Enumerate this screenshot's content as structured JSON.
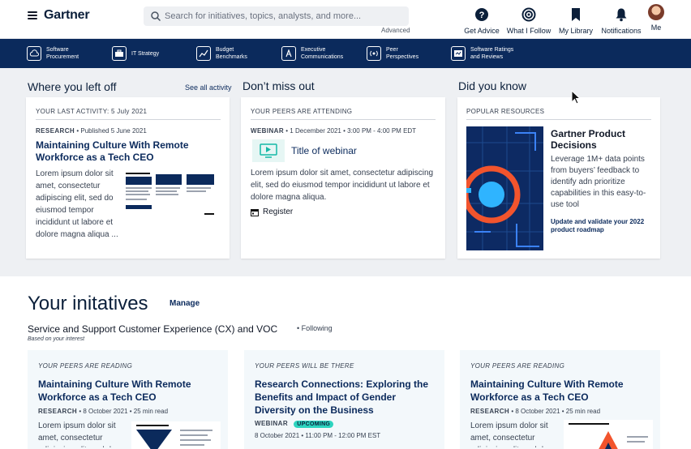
{
  "header": {
    "logo": "Gartner",
    "search_placeholder": "Search for initiatives, topics, analysts, and more...",
    "advanced": "Advanced",
    "nav": [
      {
        "label": "Get Advice",
        "icon": "question-circle-icon"
      },
      {
        "label": "What I Follow",
        "icon": "radar-icon"
      },
      {
        "label": "My Library",
        "icon": "bookmark-icon"
      },
      {
        "label": "Notifications",
        "icon": "bell-icon"
      },
      {
        "label": "Me",
        "icon": "avatar"
      }
    ]
  },
  "subnav": [
    {
      "label_line1": "Software",
      "label_line2": "Procurement",
      "icon": "cloud-icon"
    },
    {
      "label_line1": "IT Strategy",
      "label_line2": "",
      "icon": "briefcase-icon"
    },
    {
      "label_line1": "Budget",
      "label_line2": "Benchmarks",
      "icon": "trend-chart-icon"
    },
    {
      "label_line1": "Executive",
      "label_line2": "Communications",
      "icon": "compass-icon"
    },
    {
      "label_line1": "Peer",
      "label_line2": "Perspectives",
      "icon": "broadcast-icon"
    },
    {
      "label_line1": "Software Ratings",
      "label_line2": "and Reviews",
      "icon": "rating-icon"
    }
  ],
  "left_off": {
    "title": "Where you left off",
    "see_all": "See all activity",
    "eyebrow": "YOUR LAST ACTIVITY:",
    "eyebrow_date": "5 July 2021",
    "type": "RESEARCH",
    "published": "• Published 5 June 2021",
    "card_title": "Maintaining Culture With Remote Workforce as a Tech CEO",
    "body": "Lorem ipsum dolor sit amet, consectetur adipiscing elit, sed do eiusmod tempor incididunt ut labore et dolore magna aliqua ..."
  },
  "dont_miss": {
    "title": "Don’t miss out",
    "eyebrow": "YOUR PEERS ARE ATTENDING",
    "type": "WEBINAR",
    "date": "• 1 December 2021",
    "time": "• 3:00 PM - 4:00 PM EDT",
    "webinar_title": "Title of webinar",
    "body": "Lorem ipsum dolor sit amet, consectetur adipiscing elit, sed do eiusmod tempor incididunt ut labore et dolore magna aliqua.",
    "register": "Register"
  },
  "did_you_know": {
    "title": "Did you know",
    "eyebrow": "POPULAR RESOURCES",
    "promo_title": "Gartner Product Decisions",
    "promo_body": "Leverage 1M+ data points from buyers’ feedback to identify adn prioritize capabilities in this easy-to-use tool",
    "promo_link": "Update and validate your 2022 product roadmap"
  },
  "initiatives": {
    "title": "Your initatives",
    "manage": "Manage",
    "subtitle": "Service and Support Customer Experience (CX) and VOC",
    "following": "• Following",
    "based_on": "Based on your interest",
    "cards": [
      {
        "eyebrow": "YOUR PEERS ARE READING",
        "title": "Maintaining Culture With Remote Workforce as a Tech CEO",
        "type": "RESEARCH",
        "date": "• 8 October 2021",
        "extra": "• 25 min read",
        "body": "Lorem ipsum dolor sit amet, consectetur adipiscing elit, sed do"
      },
      {
        "eyebrow": "YOUR PEERS WILL BE THERE",
        "title": "Research Connections: Exploring the Benefits and Impact of Gender Diversity on the Business",
        "type": "WEBINAR",
        "badge": "UPCOMING",
        "date": "8 October 2021",
        "extra": "• 11:00 PM - 12:00 PM EST"
      },
      {
        "eyebrow": "YOUR PEERS ARE READING",
        "title": "Maintaining Culture With Remote Workforce as a Tech CEO",
        "type": "RESEARCH",
        "date": "• 8 October 2021",
        "extra": "• 25 min read",
        "body": "Lorem ipsum dolor sit amet, consectetur adipiscing elit, sed do"
      }
    ]
  }
}
